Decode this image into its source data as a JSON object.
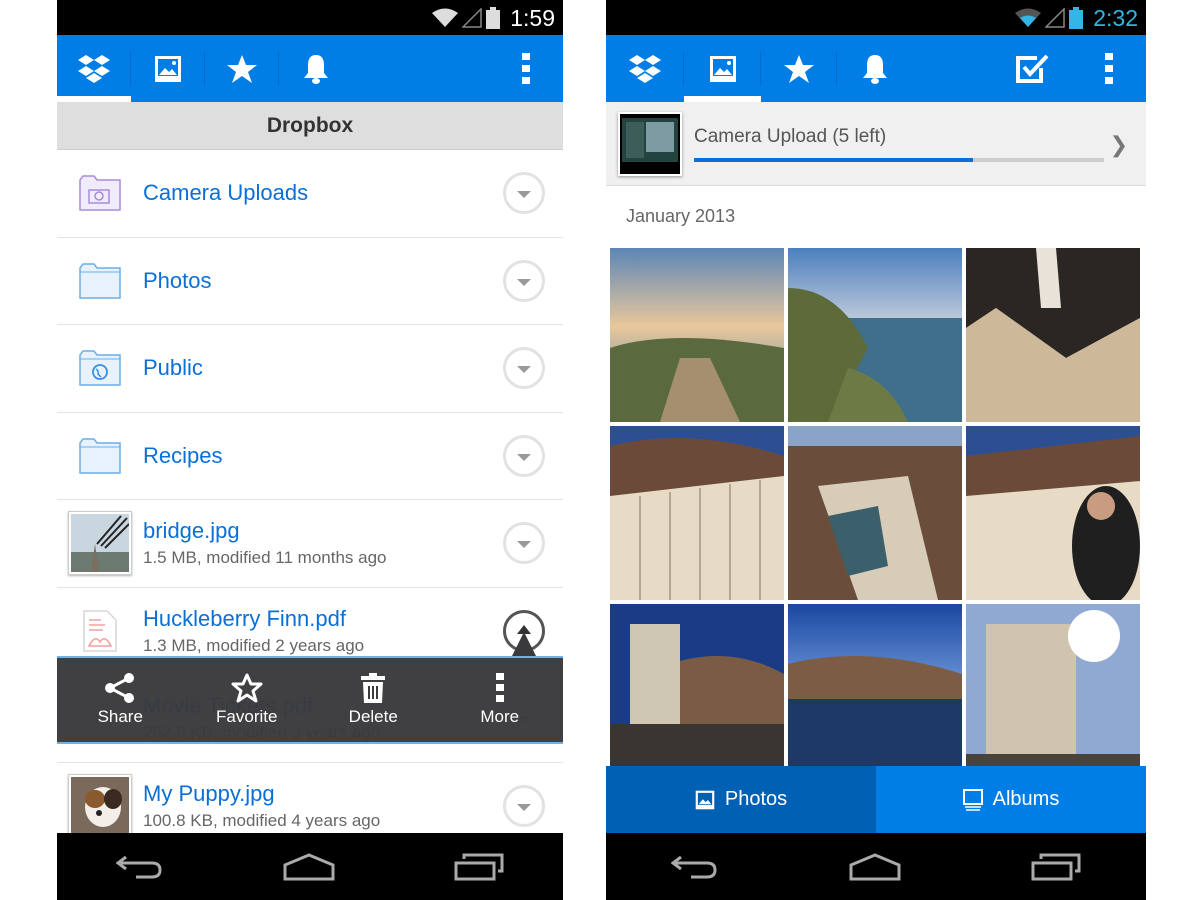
{
  "left_screen": {
    "status_bar": {
      "time": "1:59"
    },
    "action_bar": {
      "tabs": [
        {
          "name": "dropbox",
          "icon": "dropbox-icon",
          "active": true
        },
        {
          "name": "photos",
          "icon": "photo-icon",
          "active": false
        },
        {
          "name": "favorites",
          "icon": "star-icon",
          "active": false
        },
        {
          "name": "notifications",
          "icon": "bell-icon",
          "active": false
        }
      ],
      "overflow_icon": "overflow-menu-icon"
    },
    "location_title": "Dropbox",
    "items": [
      {
        "name": "Camera Uploads",
        "type": "folder",
        "icon": "camera-folder-icon"
      },
      {
        "name": "Photos",
        "type": "folder",
        "icon": "folder-icon"
      },
      {
        "name": "Public",
        "type": "folder",
        "icon": "public-folder-icon"
      },
      {
        "name": "Recipes",
        "type": "folder",
        "icon": "folder-icon"
      },
      {
        "name": "bridge.jpg",
        "meta": "1.5 MB, modified 11 months ago",
        "type": "image"
      },
      {
        "name": "Huckleberry Finn.pdf",
        "meta": "1.3 MB, modified 2 years ago",
        "type": "pdf"
      },
      {
        "name": "Movie Tickets.pdf",
        "meta": "262.6 KB, modified 3 years ago",
        "type": "pdf"
      },
      {
        "name": "My Puppy.jpg",
        "meta": "100.8 KB, modified 4 years ago",
        "type": "image"
      }
    ],
    "quick_actions": [
      {
        "label": "Share",
        "icon": "share-icon"
      },
      {
        "label": "Favorite",
        "icon": "star-outline-icon"
      },
      {
        "label": "Delete",
        "icon": "trash-icon"
      },
      {
        "label": "More",
        "icon": "overflow-menu-icon"
      }
    ]
  },
  "right_screen": {
    "status_bar": {
      "time": "2:32"
    },
    "action_bar": {
      "tabs": [
        {
          "name": "dropbox",
          "icon": "dropbox-icon",
          "active": false
        },
        {
          "name": "photos",
          "icon": "photo-icon",
          "active": true
        },
        {
          "name": "favorites",
          "icon": "star-icon",
          "active": false
        },
        {
          "name": "notifications",
          "icon": "bell-icon",
          "active": false
        }
      ],
      "select_icon": "checkbox-icon",
      "overflow_icon": "overflow-menu-icon"
    },
    "upload": {
      "label": "Camera Upload (5 left)",
      "progress_percent": 68
    },
    "month_header": "January 2013",
    "photos_count": 9,
    "bottom_tabs": [
      {
        "label": "Photos",
        "icon": "photo-icon",
        "active": true
      },
      {
        "label": "Albums",
        "icon": "albums-icon",
        "active": false
      }
    ]
  },
  "colors": {
    "brand_blue": "#007ee5",
    "link_blue": "#0a6fd6",
    "active_tab_blue": "#0061b4",
    "status_accent": "#33b5e5"
  }
}
